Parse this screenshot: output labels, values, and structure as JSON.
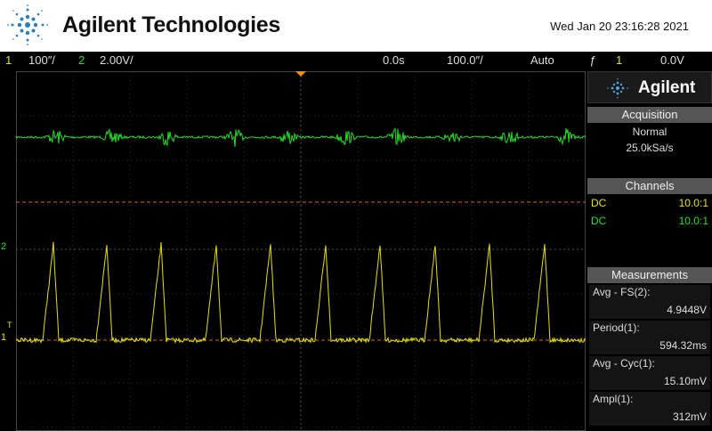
{
  "header": {
    "brand": "Agilent Technologies",
    "datetime": "Wed Jan 20 23:16:28 2021"
  },
  "status": {
    "ch1_num": "1",
    "ch1_scale": "100″/",
    "ch2_num": "2",
    "ch2_scale": "2.00V/",
    "time_offset": "0.0s",
    "time_scale": "100.0″/",
    "trigger_mode": "Auto",
    "trigger_icon": "ƒ",
    "trigger_source": "1",
    "trigger_level": "0.0V"
  },
  "panel": {
    "brand": "Agilent",
    "acquisition": {
      "title": "Acquisition",
      "mode": "Normal",
      "rate": "25.0kSa/s"
    },
    "channels": {
      "title": "Channels",
      "rows": [
        {
          "coupling": "DC",
          "probe": "10.0:1",
          "color": "#e8e000"
        },
        {
          "coupling": "DC",
          "probe": "10.0:1",
          "color": "#22dd22"
        }
      ]
    },
    "measurements": {
      "title": "Measurements",
      "items": [
        {
          "label": "Avg - FS(2):",
          "value": "4.9448V"
        },
        {
          "label": "Period(1):",
          "value": "594.32ms"
        },
        {
          "label": "Avg - Cyc(1):",
          "value": "15.10mV"
        },
        {
          "label": "Ampl(1):",
          "value": "312mV"
        }
      ]
    }
  },
  "markers": {
    "ch2": "2",
    "ch1": "1",
    "trig": "T"
  },
  "colors": {
    "ch1": "#e8e000",
    "ch2": "#22dd22",
    "grid": "#3a3a3a",
    "cursor": "#d2691e"
  }
}
